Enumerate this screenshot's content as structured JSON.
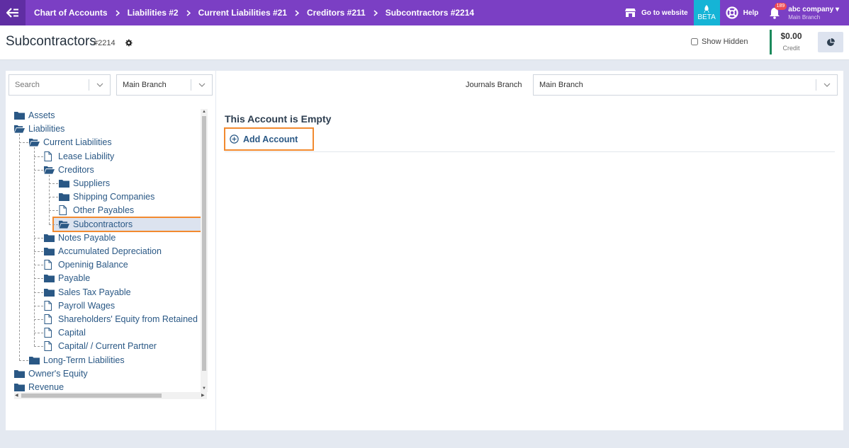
{
  "nav": {
    "breadcrumbs": [
      "Chart of Accounts",
      "Liabilities #2",
      "Current Liabilities #21",
      "Creditors #211",
      "Subcontractors #2214"
    ],
    "goto_website": "Go to website",
    "beta": "BETA",
    "help": "Help",
    "notifications_count": "189",
    "company_name": "abc company",
    "company_branch": "Main Branch"
  },
  "header": {
    "title": "Subcontractors",
    "code": "#2214",
    "show_hidden": "Show Hidden",
    "credit_amount": "$0.00",
    "credit_label": "Credit"
  },
  "left": {
    "search_placeholder": "Search",
    "branch_select": "Main Branch",
    "tree": [
      {
        "label": "Assets",
        "icon": "folder-icon"
      },
      {
        "label": "Liabilities",
        "icon": "folder-open-icon"
      },
      {
        "label": "Current Liabilities",
        "icon": "folder-open-icon"
      },
      {
        "label": "Lease Liability",
        "icon": "file-icon"
      },
      {
        "label": "Creditors",
        "icon": "folder-open-icon"
      },
      {
        "label": "Suppliers",
        "icon": "folder-icon"
      },
      {
        "label": "Shipping Companies",
        "icon": "folder-icon"
      },
      {
        "label": "Other Payables",
        "icon": "file-icon"
      },
      {
        "label": "Subcontractors",
        "icon": "folder-open-icon"
      },
      {
        "label": "Notes Payable",
        "icon": "folder-icon"
      },
      {
        "label": "Accumulated Depreciation",
        "icon": "folder-icon"
      },
      {
        "label": "Openinig Balance",
        "icon": "file-icon"
      },
      {
        "label": "Payable",
        "icon": "folder-icon"
      },
      {
        "label": "Sales Tax Payable",
        "icon": "folder-icon"
      },
      {
        "label": "Payroll Wages",
        "icon": "file-icon"
      },
      {
        "label": "Shareholders' Equity from Retained Earnings",
        "icon": "file-icon"
      },
      {
        "label": "Capital",
        "icon": "file-icon"
      },
      {
        "label": "Capital/ / Current Partner",
        "icon": "file-icon"
      },
      {
        "label": "Long-Term Liabilities",
        "icon": "folder-icon"
      },
      {
        "label": "Owner's Equity",
        "icon": "folder-icon"
      },
      {
        "label": "Revenue",
        "icon": "folder-icon"
      }
    ]
  },
  "right": {
    "journals_branch_label": "Journals Branch",
    "journals_branch_value": "Main Branch",
    "empty_title": "This Account is Empty",
    "add_account": "Add Account"
  },
  "colors": {
    "nav_bg": "#7b3fc4",
    "beta_bg": "#15b4d6",
    "highlight": "#f28a2f",
    "link": "#2a5885",
    "credit_bar": "#1c8a5c"
  }
}
